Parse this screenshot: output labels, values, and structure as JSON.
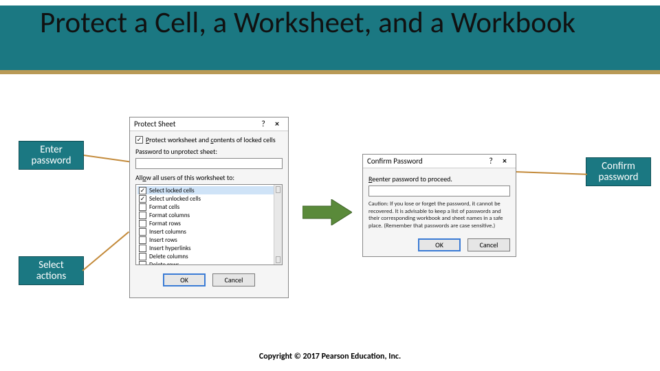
{
  "title": "Protect a Cell, a Worksheet, and a Workbook",
  "callouts": {
    "enter": "Enter password",
    "select": "Select actions",
    "confirm": "Confirm password"
  },
  "protect_dialog": {
    "title": "Protect Sheet",
    "help": "?",
    "close": "×",
    "protect_contents_label": "Protect worksheet and contents of locked cells",
    "protect_contents_checked": true,
    "password_label": "Password to unprotect sheet:",
    "password_value": "",
    "allow_label": "Allow all users of this worksheet to:",
    "options": [
      {
        "label": "Select locked cells",
        "checked": true,
        "selected": true
      },
      {
        "label": "Select unlocked cells",
        "checked": true,
        "selected": false
      },
      {
        "label": "Format cells",
        "checked": false,
        "selected": false
      },
      {
        "label": "Format columns",
        "checked": false,
        "selected": false
      },
      {
        "label": "Format rows",
        "checked": false,
        "selected": false
      },
      {
        "label": "Insert columns",
        "checked": false,
        "selected": false
      },
      {
        "label": "Insert rows",
        "checked": false,
        "selected": false
      },
      {
        "label": "Insert hyperlinks",
        "checked": false,
        "selected": false
      },
      {
        "label": "Delete columns",
        "checked": false,
        "selected": false
      },
      {
        "label": "Delete rows",
        "checked": false,
        "selected": false
      }
    ],
    "ok": "OK",
    "cancel": "Cancel"
  },
  "confirm_dialog": {
    "title": "Confirm Password",
    "help": "?",
    "close": "×",
    "reenter_label": "Reenter password to proceed.",
    "reenter_value": "",
    "caution": "Caution: If you lose or forget the password, it cannot be recovered. It is advisable to keep a list of passwords and their corresponding workbook and sheet names in a safe place. (Remember that passwords are case sensitive.)",
    "ok": "OK",
    "cancel": "Cancel"
  },
  "footer": "Copyright © 2017 Pearson Education, Inc.",
  "colors": {
    "teal": "#1b7882",
    "gold": "#b99a56",
    "arrow": "#5a8a3a"
  }
}
